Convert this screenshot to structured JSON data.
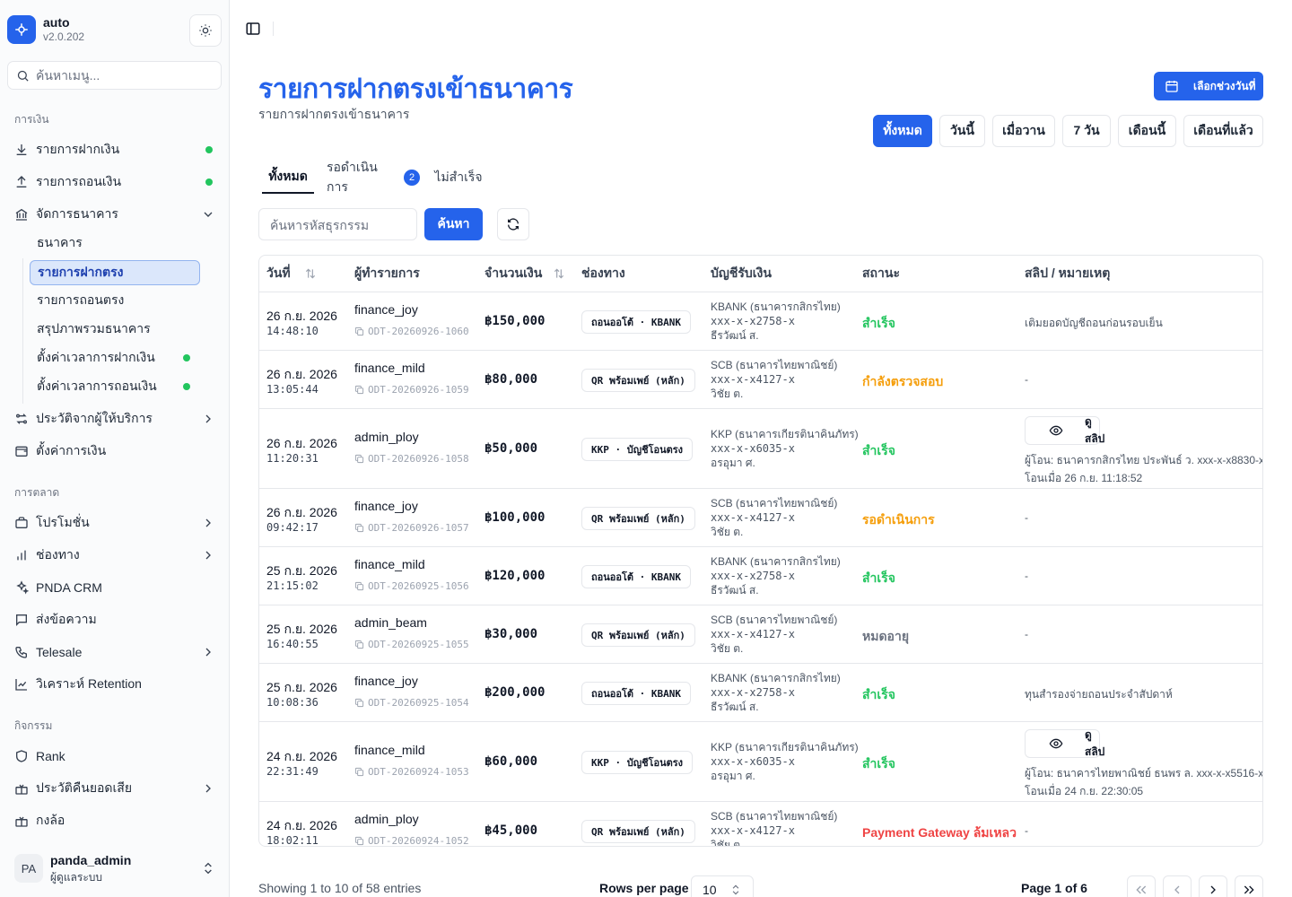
{
  "sidebar": {
    "app_name": "auto",
    "version": "v2.0.202",
    "search_placeholder": "ค้นหาเมนู...",
    "sections": {
      "finance": "การเงิน",
      "marketing": "การตลาด",
      "activity": "กิจกรรม"
    },
    "items": {
      "deposits": "รายการฝากเงิน",
      "withdrawals": "รายการถอนเงิน",
      "bank_manage": "จัดการธนาคาร",
      "provider_history": "ประวัติจากผู้ให้บริการ",
      "finance_settings": "ตั้งค่าการเงิน",
      "promotions": "โปรโมชั่น",
      "channels": "ช่องทาง",
      "crm": "PNDA CRM",
      "messages": "ส่งข้อความ",
      "telesale": "Telesale",
      "retention": "วิเคราะห์ Retention",
      "rank": "Rank",
      "cashback": "ประวัติคืนยอดเสีย",
      "box": "กงล้อ"
    },
    "bank_sub": {
      "banks": "ธนาคาร",
      "direct_deposit": "รายการฝากตรง",
      "direct_withdraw": "รายการถอนตรง",
      "bank_overview": "สรุปภาพรวมธนาคาร",
      "deposit_time": "ตั้งค่าเวลาการฝากเงิน",
      "withdraw_time": "ตั้งค่าเวลาการถอนเงิน"
    },
    "user": {
      "initials": "PA",
      "name": "panda_admin",
      "role": "ผู้ดูแลระบบ"
    }
  },
  "header": {
    "title": "รายการฝากตรงเข้าธนาคาร",
    "subtitle": "รายการฝากตรงเข้าธนาคาร",
    "date_range_button": "เลือกช่วงวันที่",
    "ranges": [
      "ทั้งหมด",
      "วันนี้",
      "เมื่อวาน",
      "7 วัน",
      "เดือนนี้",
      "เดือนที่แล้ว"
    ]
  },
  "tabs": {
    "all": "ทั้งหมด",
    "pending": "รอดำเนินการ",
    "pending_count": "2",
    "failed": "ไม่สำเร็จ"
  },
  "toolbar": {
    "search_placeholder": "ค้นหารหัสธุรกรรม",
    "search_button": "ค้นหา"
  },
  "table": {
    "columns": [
      "วันที่",
      "ผู้ทำรายการ",
      "จำนวนเงิน",
      "ช่องทาง",
      "บัญชีรับเงิน",
      "สถานะ",
      "สลิป / หมายเหตุ"
    ],
    "slip_button": "ดูสลิป",
    "rows": [
      {
        "date": "26 ก.ย. 2026",
        "time": "14:48:10",
        "user": "finance_joy",
        "ref": "ODT-20260926-1060",
        "amount": "฿150,000",
        "channel": "ถอนออโต้ · KBANK",
        "bank": "KBANK (ธนาคารกสิกรไทย)",
        "account": "xxx-x-x2758-x",
        "holder": "ธีรวัฒน์ ส.",
        "status": "สำเร็จ",
        "status_color": "#22c55e",
        "note": "เติมยอดบัญชีถอนก่อนรอบเย็น"
      },
      {
        "date": "26 ก.ย. 2026",
        "time": "13:05:44",
        "user": "finance_mild",
        "ref": "ODT-20260926-1059",
        "amount": "฿80,000",
        "channel": "QR พร้อมเพย์ (หลัก)",
        "bank": "SCB (ธนาคารไทยพาณิชย์)",
        "account": "xxx-x-x4127-x",
        "holder": "วิชัย ต.",
        "status": "กำลังตรวจสอบ",
        "status_color": "#f59e0b",
        "note": "-"
      },
      {
        "date": "26 ก.ย. 2026",
        "time": "11:20:31",
        "user": "admin_ploy",
        "ref": "ODT-20260926-1058",
        "amount": "฿50,000",
        "channel": "KKP · บัญชีโอนตรง",
        "bank": "KKP (ธนาคารเกียรตินาคินภัทร)",
        "account": "xxx-x-x6035-x",
        "holder": "อรอุมา ศ.",
        "status": "สำเร็จ",
        "status_color": "#22c55e",
        "slip": true,
        "slip_from": "ผู้โอน: ธนาคารกสิกรไทย ประพันธ์ ว. xxx-x-x8830-x",
        "slip_time": "โอนเมื่อ 26 ก.ย. 11:18:52"
      },
      {
        "date": "26 ก.ย. 2026",
        "time": "09:42:17",
        "user": "finance_joy",
        "ref": "ODT-20260926-1057",
        "amount": "฿100,000",
        "channel": "QR พร้อมเพย์ (หลัก)",
        "bank": "SCB (ธนาคารไทยพาณิชย์)",
        "account": "xxx-x-x4127-x",
        "holder": "วิชัย ต.",
        "status": "รอดำเนินการ",
        "status_color": "#f59e0b",
        "note": "-"
      },
      {
        "date": "25 ก.ย. 2026",
        "time": "21:15:02",
        "user": "finance_mild",
        "ref": "ODT-20260925-1056",
        "amount": "฿120,000",
        "channel": "ถอนออโต้ · KBANK",
        "bank": "KBANK (ธนาคารกสิกรไทย)",
        "account": "xxx-x-x2758-x",
        "holder": "ธีรวัฒน์ ส.",
        "status": "สำเร็จ",
        "status_color": "#22c55e",
        "note": "-"
      },
      {
        "date": "25 ก.ย. 2026",
        "time": "16:40:55",
        "user": "admin_beam",
        "ref": "ODT-20260925-1055",
        "amount": "฿30,000",
        "channel": "QR พร้อมเพย์ (หลัก)",
        "bank": "SCB (ธนาคารไทยพาณิชย์)",
        "account": "xxx-x-x4127-x",
        "holder": "วิชัย ต.",
        "status": "หมดอายุ",
        "status_color": "#6b7280",
        "note": "-"
      },
      {
        "date": "25 ก.ย. 2026",
        "time": "10:08:36",
        "user": "finance_joy",
        "ref": "ODT-20260925-1054",
        "amount": "฿200,000",
        "channel": "ถอนออโต้ · KBANK",
        "bank": "KBANK (ธนาคารกสิกรไทย)",
        "account": "xxx-x-x2758-x",
        "holder": "ธีรวัฒน์ ส.",
        "status": "สำเร็จ",
        "status_color": "#22c55e",
        "note": "ทุนสำรองจ่ายถอนประจำสัปดาห์"
      },
      {
        "date": "24 ก.ย. 2026",
        "time": "22:31:49",
        "user": "finance_mild",
        "ref": "ODT-20260924-1053",
        "amount": "฿60,000",
        "channel": "KKP · บัญชีโอนตรง",
        "bank": "KKP (ธนาคารเกียรตินาคินภัทร)",
        "account": "xxx-x-x6035-x",
        "holder": "อรอุมา ศ.",
        "status": "สำเร็จ",
        "status_color": "#22c55e",
        "slip": true,
        "slip_from": "ผู้โอน: ธนาคารไทยพาณิชย์ ธนพร ล. xxx-x-x5516-x",
        "slip_time": "โอนเมื่อ 24 ก.ย. 22:30:05"
      },
      {
        "date": "24 ก.ย. 2026",
        "time": "18:02:11",
        "user": "admin_ploy",
        "ref": "ODT-20260924-1052",
        "amount": "฿45,000",
        "channel": "QR พร้อมเพย์ (หลัก)",
        "bank": "SCB (ธนาคารไทยพาณิชย์)",
        "account": "xxx-x-x4127-x",
        "holder": "วิชัย ต.",
        "status": "Payment Gateway ล้มเหลว",
        "status_color": "#ef4444",
        "note": "-"
      }
    ]
  },
  "footer": {
    "showing": "Showing 1 to 10 of 58 entries",
    "rows_per_page_label": "Rows per page",
    "rows_per_page": "10",
    "page_info": "Page 1 of 6"
  },
  "colors": {
    "accent": "#2563eb",
    "success": "#22c55e",
    "warning": "#f59e0b",
    "danger": "#ef4444"
  }
}
